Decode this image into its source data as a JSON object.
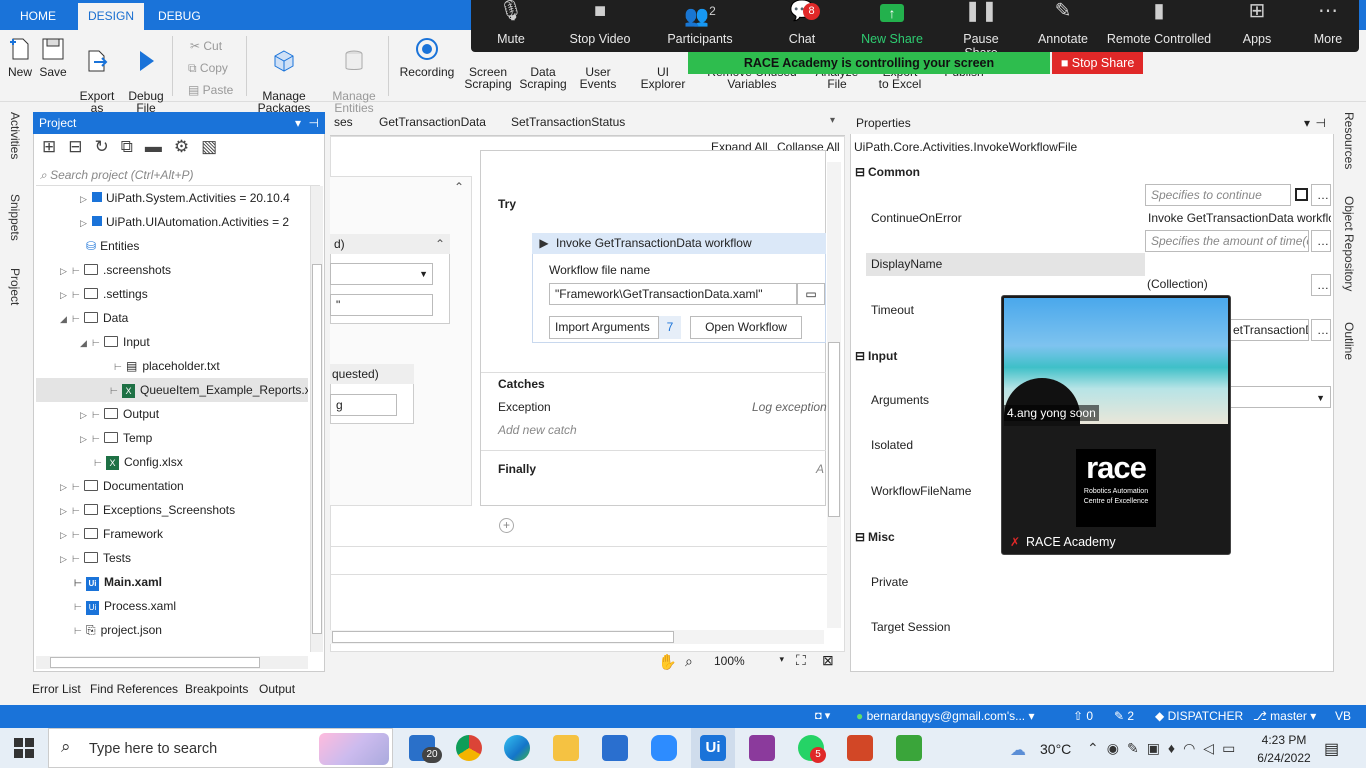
{
  "tabs": {
    "home": "HOME",
    "design": "DESIGN",
    "debug": "DEBUG"
  },
  "ribbon": {
    "new": "New",
    "save": "Save",
    "export_template": "Export as\nTemplate",
    "debug_file": "Debug\nFile",
    "cut": "Cut",
    "copy": "Copy",
    "paste": "Paste",
    "manage_packages": "Manage\nPackages",
    "manage_entities": "Manage\nEntities",
    "recording": "Recording",
    "screen_scraping": "Screen\nScraping",
    "data_scraping": "Data\nScraping",
    "user_events": "User\nEvents",
    "ui_explorer": "UI\nExplorer",
    "remove_unused": "Remove Unused\nVariables",
    "analyze_file": "Analyze\nFile",
    "export_excel": "Export\nto Excel",
    "publish": "Publish"
  },
  "zoom": {
    "mute": "Mute",
    "stop_video": "Stop Video",
    "participants": "Participants",
    "participants_count": "2",
    "chat": "Chat",
    "chat_badge": "8",
    "new_share": "New Share",
    "pause_share": "Pause Share",
    "annotate": "Annotate",
    "remote_controlled": "Remote Controlled",
    "apps": "Apps",
    "more": "More",
    "controlling_text": "RACE Academy is controlling your screen",
    "stop_share": "Stop Share"
  },
  "left_sidebar": {
    "activities": "Activities",
    "snippets": "Snippets",
    "project": "Project"
  },
  "project": {
    "title": "Project",
    "search_placeholder": "Search project (Ctrl+Alt+P)",
    "items": [
      {
        "label": "UiPath.System.Activities = 20.10.4"
      },
      {
        "label": "UiPath.UIAutomation.Activities = 2"
      },
      {
        "label": "Entities"
      },
      {
        "label": ".screenshots"
      },
      {
        "label": ".settings"
      },
      {
        "label": "Data"
      },
      {
        "label": "Input"
      },
      {
        "label": "placeholder.txt"
      },
      {
        "label": "QueueItem_Example_Reports.x"
      },
      {
        "label": "Output"
      },
      {
        "label": "Temp"
      },
      {
        "label": "Config.xlsx"
      },
      {
        "label": "Documentation"
      },
      {
        "label": "Exceptions_Screenshots"
      },
      {
        "label": "Framework"
      },
      {
        "label": "Tests"
      },
      {
        "label": "Main.xaml"
      },
      {
        "label": "Process.xaml"
      },
      {
        "label": "project.json"
      }
    ]
  },
  "designer": {
    "tabs": [
      "ses",
      "GetTransactionData",
      "SetTransactionStatus"
    ],
    "expand_all": "Expand All",
    "collapse_all": "Collapse All",
    "try": "Try",
    "invoke_title": "Invoke GetTransactionData workflow",
    "workflow_file_label": "Workflow file name",
    "workflow_file_value": "\"Framework\\GetTransactionData.xaml\"",
    "import_arguments": "Import Arguments",
    "import_count": "7",
    "open_workflow": "Open Workflow",
    "catches": "Catches",
    "exception": "Exception",
    "log_exception": "Log exception",
    "add_catch": "Add new catch",
    "finally": "Finally",
    "finally_a": "A",
    "left_fragment_1": "d)",
    "left_fragment_2": "\"",
    "left_fragment_3": "quested)",
    "left_fragment_4": "g",
    "zoom": "100%"
  },
  "properties": {
    "title": "Properties",
    "type": "UiPath.Core.Activities.InvokeWorkflowFile",
    "common": "Common",
    "continue_on_error": "ContinueOnError",
    "continue_ph": "Specifies to continue execu",
    "display_name": "DisplayName",
    "display_value": "Invoke GetTransactionData workflo",
    "timeout": "Timeout",
    "timeout_ph": "Specifies the amount of time(c",
    "input": "Input",
    "arguments": "Arguments",
    "arguments_value": "(Collection)",
    "isolated": "Isolated",
    "workflow_file_name": "WorkflowFileName",
    "wf_value": "etTransactionD",
    "misc": "Misc",
    "private": "Private",
    "target_session": "Target Session"
  },
  "right_sidebar": {
    "resources": "Resources",
    "object_repository": "Object Repository",
    "outline": "Outline"
  },
  "video": {
    "name1": "4.ang yong soon",
    "name2": "RACE Academy",
    "logo": "race",
    "logo_sub1": "Robotics Automation",
    "logo_sub2": "Centre of Excellence"
  },
  "bottom_tabs": [
    "Error List",
    "Find References",
    "Breakpoints",
    "Output"
  ],
  "status": {
    "account": "bernardangys@gmail.com's...",
    "up": "0",
    "edits": "2",
    "dispatcher": "DISPATCHER",
    "branch": "master",
    "lang": "VB"
  },
  "taskbar": {
    "search": "Type here to search",
    "mail_badge": "20",
    "whatsapp_badge": "5",
    "temp": "30°C",
    "time": "4:23 PM",
    "date": "6/24/2022",
    "ui_label": "Ui"
  }
}
